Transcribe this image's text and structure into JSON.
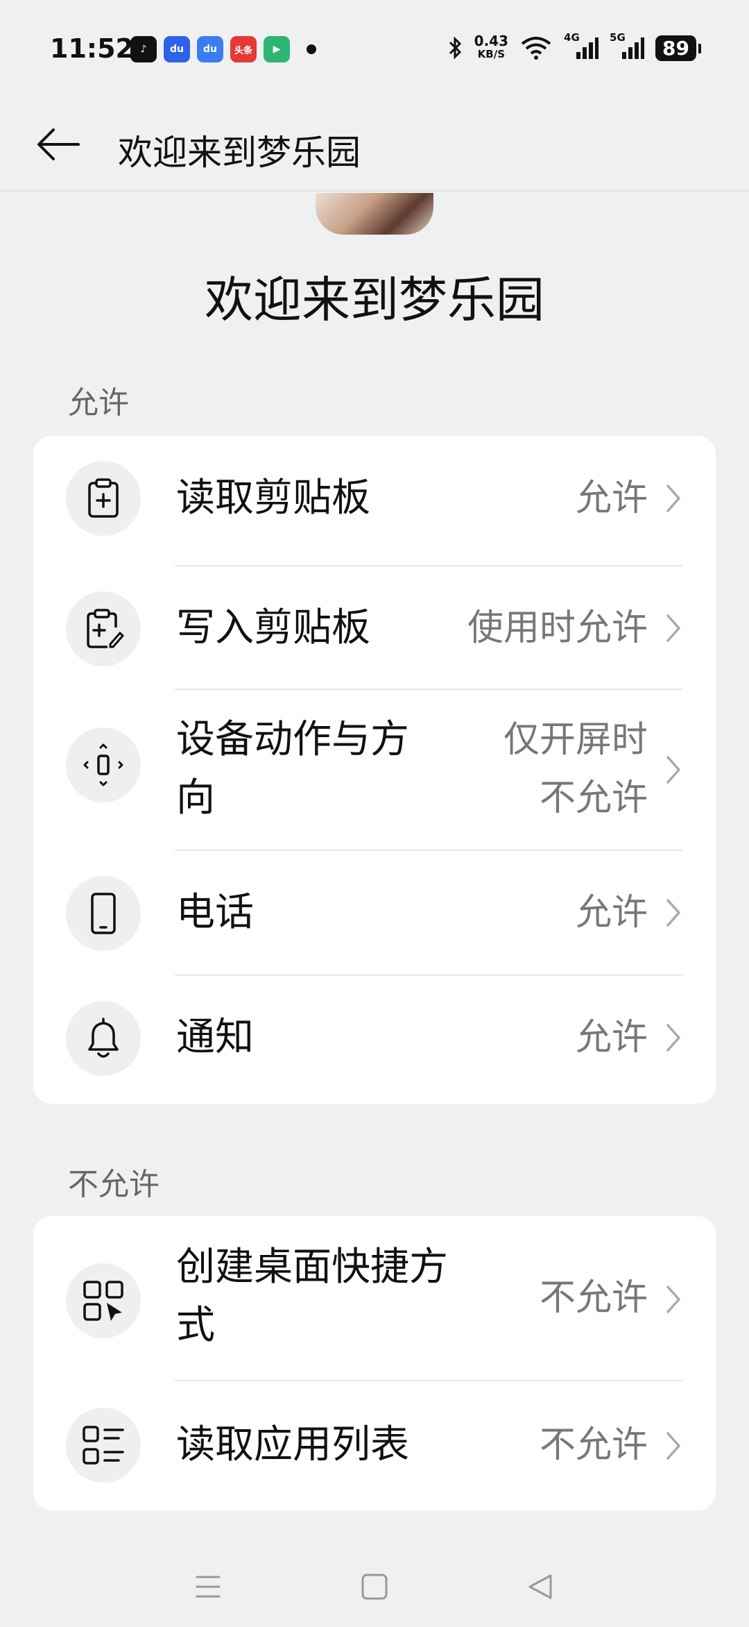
{
  "status_bar": {
    "time": "11:52",
    "apps": [
      {
        "icon": "douyin-icon",
        "label": "♪",
        "color": "#111111"
      },
      {
        "icon": "baidu-icon",
        "label": "du",
        "color": "#2d62e8"
      },
      {
        "icon": "baidu-map-icon",
        "label": "du",
        "color": "#3b7df0"
      },
      {
        "icon": "toutiao-icon",
        "label": "头条",
        "color": "#e53935"
      },
      {
        "icon": "video-app-icon",
        "label": "▶",
        "color": "#2bb673"
      }
    ],
    "net_speed": "0.43",
    "net_unit": "KB/S",
    "sig1": "4G",
    "sig2": "5G",
    "battery": "89"
  },
  "app_bar": {
    "title": "欢迎来到梦乐园"
  },
  "header": {
    "app_name": "欢迎来到梦乐园"
  },
  "allowed_section": {
    "label": "允许",
    "items": [
      {
        "label": "读取剪贴板",
        "value": "允许",
        "icon": "clipboard-plus-icon"
      },
      {
        "label": "写入剪贴板",
        "value": "使用时允许",
        "icon": "clipboard-edit-icon"
      },
      {
        "label": "设备动作与方向",
        "label_lines": [
          "设备动作与方",
          "向"
        ],
        "value_lines": [
          "仅开屏时",
          "不允许"
        ],
        "icon": "device-motion-icon"
      },
      {
        "label": "电话",
        "value": "允许",
        "icon": "phone-icon"
      },
      {
        "label": "通知",
        "value": "允许",
        "icon": "bell-icon"
      }
    ]
  },
  "denied_section": {
    "label": "不允许",
    "items": [
      {
        "label_lines": [
          "创建桌面快捷方",
          "式"
        ],
        "value": "不允许",
        "icon": "shortcut-icon"
      },
      {
        "label": "读取应用列表",
        "value": "不允许",
        "icon": "app-list-icon"
      }
    ]
  }
}
